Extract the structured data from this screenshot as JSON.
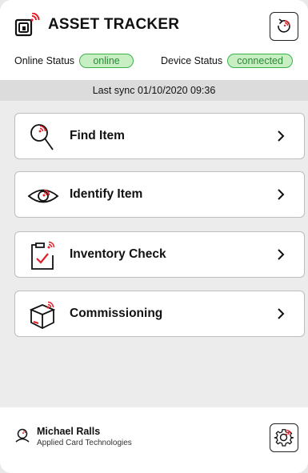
{
  "app": {
    "title": "ASSET TRACKER",
    "logo_icon": "tag-wireless-icon",
    "sync_icon": "refresh-wireless-icon"
  },
  "status": {
    "online_label": "Online Status",
    "online_value": "online",
    "device_label": "Device Status",
    "device_value": "connected",
    "pill_color": "#3ab24a",
    "pill_bg": "#c8eec3"
  },
  "sync": {
    "text": "Last sync 01/10/2020  09:36"
  },
  "menu": [
    {
      "label": "Find Item",
      "icon": "magnifier-icon"
    },
    {
      "label": "Identify Item",
      "icon": "eye-icon"
    },
    {
      "label": "Inventory Check",
      "icon": "clipboard-check-icon"
    },
    {
      "label": "Commissioning",
      "icon": "box-icon"
    }
  ],
  "user": {
    "name": "Michael Ralls",
    "organization": "Applied Card Technologies",
    "icon": "user-icon"
  },
  "settings": {
    "icon": "gear-icon"
  },
  "colors": {
    "accent": "#e0202a",
    "text": "#111111",
    "border": "#bdbdbd"
  }
}
